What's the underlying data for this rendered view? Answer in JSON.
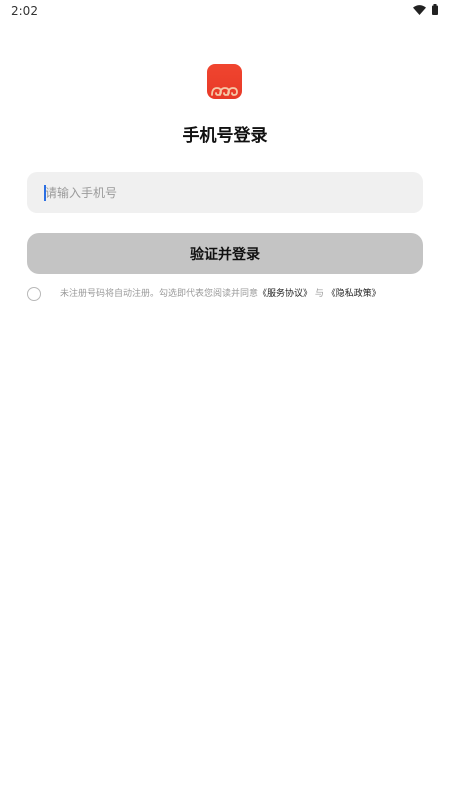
{
  "status_bar": {
    "time": "2:02"
  },
  "icons": {
    "logo": "auspicious-cloud-logo-icon",
    "wifi": "wifi-icon",
    "battery": "battery-icon"
  },
  "colors": {
    "logo_red": "#e83a28",
    "logo_cloud": "#f5c8a8",
    "input_bg": "#f0f0f0",
    "button_bg": "#c4c4c4",
    "link": "#222222",
    "muted_text": "#9a9a9a"
  },
  "login": {
    "title": "手机号登录",
    "phone_placeholder": "请输入手机号",
    "phone_value": "",
    "submit_label": "验证并登录"
  },
  "agreement": {
    "prefix": "未注册号码将自动注册。勾选即代表您阅读并同意",
    "service_link": "《服务协议》",
    "joiner": "与",
    "privacy_link": "《隐私政策》",
    "checked": false
  }
}
